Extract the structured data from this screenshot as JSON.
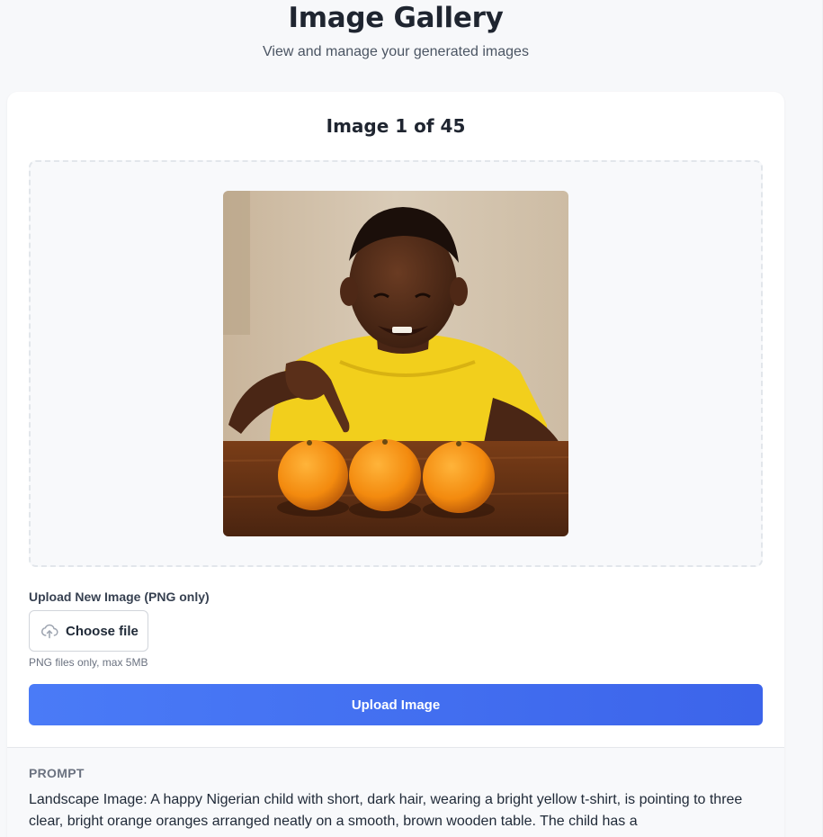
{
  "header": {
    "title": "Image Gallery",
    "subtitle": "View and manage your generated images"
  },
  "gallery": {
    "counter": "Image 1 of 45",
    "image_alt": "A happy child in a yellow t-shirt pointing at three oranges on a wooden table"
  },
  "upload": {
    "label": "Upload New Image (PNG only)",
    "choose_file_label": "Choose file",
    "choose_file_icon": "cloud-upload-icon",
    "hint": "PNG files only, max 5MB",
    "button_label": "Upload Image"
  },
  "prompt": {
    "heading": "PROMPT",
    "text": "Landscape Image: A happy Nigerian child with short, dark hair, wearing a bright yellow t-shirt, is pointing to three clear, bright orange oranges arranged neatly on a smooth, brown wooden table. The child has a"
  },
  "colors": {
    "primary_gradient_start": "#4a7bf7",
    "primary_gradient_end": "#3c64ea",
    "page_background": "#f7f8fa",
    "card_background": "#ffffff"
  }
}
